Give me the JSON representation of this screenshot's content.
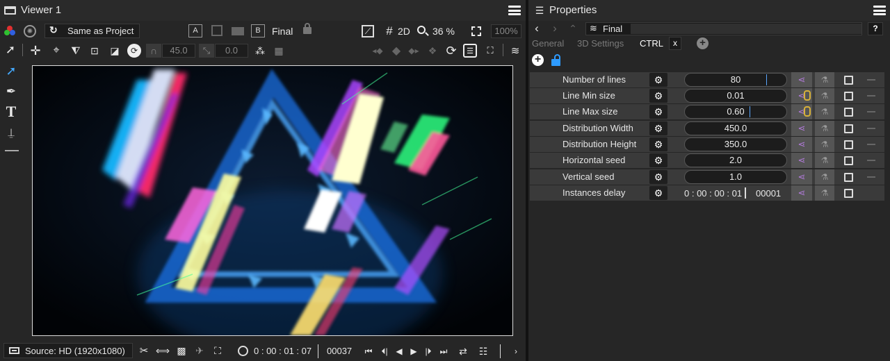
{
  "viewer": {
    "title": "Viewer 1",
    "project_label": "Same as Project",
    "a_label": "A",
    "b_label": "B",
    "final_label": "Final",
    "mode_2d": "2D",
    "zoom": "36 %",
    "zoom_pct": "100%",
    "angle_value": "45.0",
    "offset_value": "0.0",
    "source_label": "Source: HD (1920x1080)",
    "timecode": "0 : 00 : 01 : 07",
    "frame": "00037"
  },
  "properties": {
    "title": "Properties",
    "layer_name": "Final",
    "help": "?",
    "tabs": [
      {
        "label": "General"
      },
      {
        "label": "3D Settings"
      },
      {
        "label": "CTRL"
      },
      {
        "label": "x"
      }
    ],
    "rows": [
      {
        "label": "Number of lines",
        "value": "80"
      },
      {
        "label": "Line Min size",
        "value": "0.01"
      },
      {
        "label": "Line Max size",
        "value": "0.60"
      },
      {
        "label": "Distribution Width",
        "value": "450.0"
      },
      {
        "label": "Distribution Height",
        "value": "350.0"
      },
      {
        "label": "Horizontal seed",
        "value": "2.0"
      },
      {
        "label": "Vertical seed",
        "value": "1.0"
      },
      {
        "label": "Instances delay",
        "timecode": "0 : 00 : 00 : 01",
        "frames": "00001"
      }
    ]
  },
  "icons": [
    "viewer-window-icon",
    "hamburger-menu-icon",
    "color-channels-icon",
    "shutter-icon",
    "refresh-icon",
    "lock-icon",
    "transparency-icon",
    "grid-icon",
    "zoom-icon",
    "fit-screen-icon",
    "select-arrow-icon",
    "move-icon",
    "anchor-icon",
    "skew-icon",
    "crop-icon",
    "scale-icon",
    "rotate-icon",
    "magnet-icon",
    "pen-icon",
    "text-icon",
    "stamp-icon",
    "keyframe-icon",
    "loop-icon",
    "settings-icon",
    "gear-icon",
    "share-icon",
    "flask-icon",
    "add-icon",
    "unlock-icon",
    "back-icon",
    "forward-icon",
    "up-icon",
    "layers-icon",
    "play-icon"
  ],
  "colors": {
    "accent": "#44aaff",
    "link": "#b07ad8",
    "lock": "#d9b23a"
  }
}
